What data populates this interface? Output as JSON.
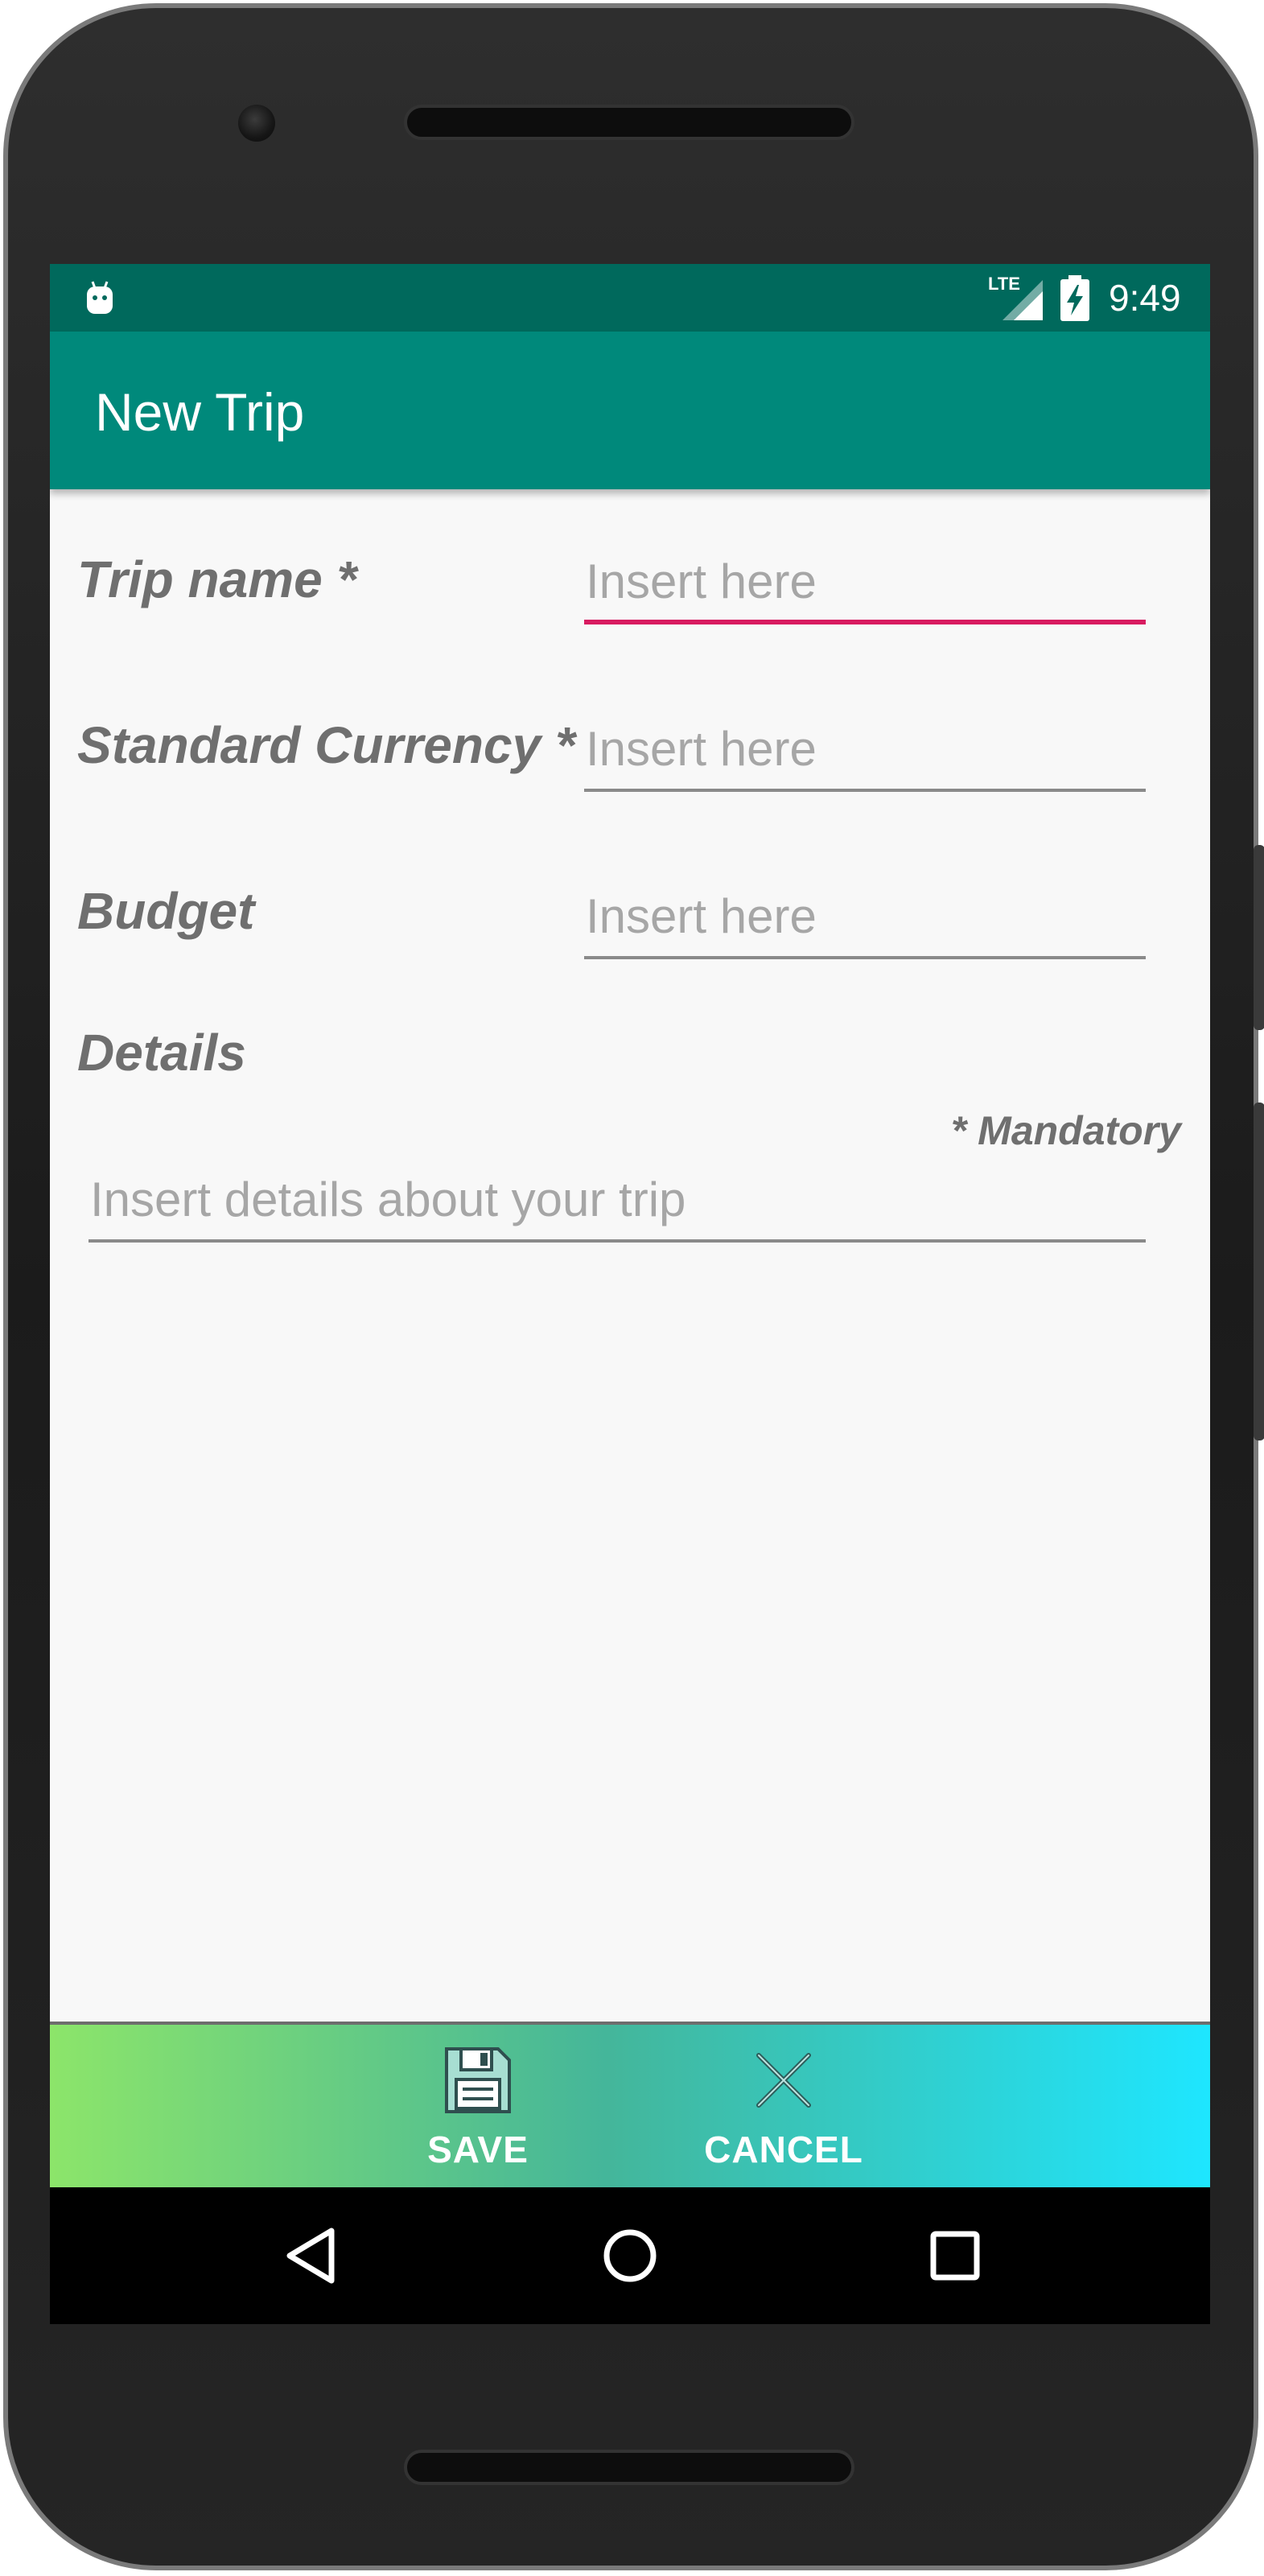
{
  "status_bar": {
    "network_label": "LTE",
    "time": "9:49",
    "icons": [
      "android-icon",
      "signal-icon",
      "battery-charging-icon"
    ]
  },
  "app_bar": {
    "title": "New Trip"
  },
  "form": {
    "trip_name": {
      "label": "Trip name *",
      "placeholder": "Insert here",
      "focused": true
    },
    "currency": {
      "label": "Standard Currency *",
      "placeholder": "Insert here"
    },
    "budget": {
      "label": "Budget",
      "placeholder": "Insert here"
    },
    "details": {
      "label": "Details",
      "placeholder": "Insert details about your trip"
    },
    "mandatory_note": "* Mandatory"
  },
  "actions": {
    "save": {
      "label": "SAVE",
      "icon": "floppy-disk-icon"
    },
    "cancel": {
      "label": "CANCEL",
      "icon": "close-icon"
    }
  },
  "nav": {
    "icons": [
      "back-icon",
      "home-icon",
      "recents-icon"
    ]
  },
  "colors": {
    "status_bar": "#00695c",
    "app_bar": "#00897b",
    "accent": "#d81b60",
    "action_gradient_start": "#8ce56a",
    "action_gradient_end": "#1ee6ff"
  }
}
